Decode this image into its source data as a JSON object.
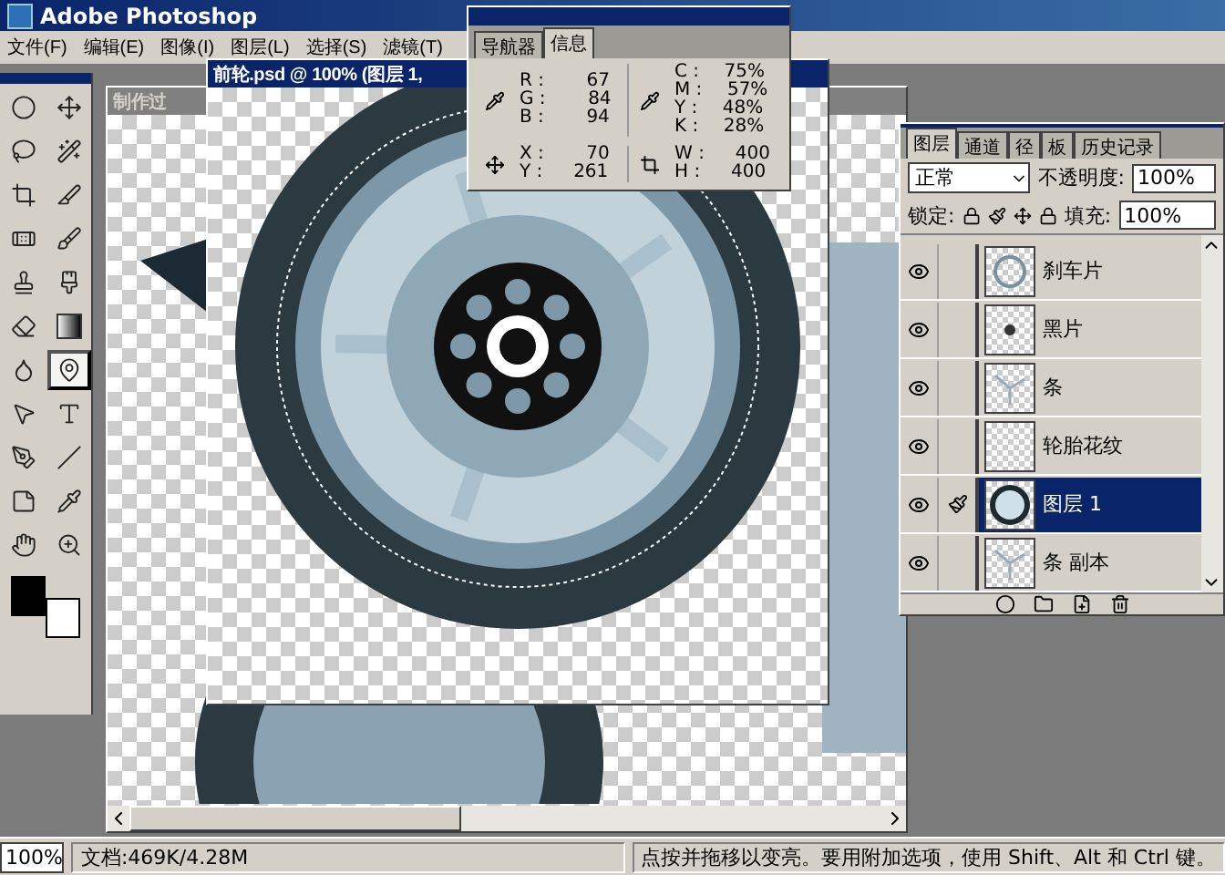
{
  "window": {
    "title": "Adobe Photoshop"
  },
  "menu": [
    "文件(F)",
    "编辑(E)",
    "图像(I)",
    "图层(L)",
    "选择(S)",
    "滤镜(T)"
  ],
  "tools": [
    {
      "kind": "marquee",
      "selected": false
    },
    {
      "kind": "move",
      "selected": false
    },
    {
      "kind": "lasso",
      "selected": false
    },
    {
      "kind": "wand",
      "selected": false
    },
    {
      "kind": "crop",
      "selected": false
    },
    {
      "kind": "slice",
      "selected": false
    },
    {
      "kind": "heal",
      "selected": false
    },
    {
      "kind": "brush",
      "selected": false
    },
    {
      "kind": "stamp",
      "selected": false
    },
    {
      "kind": "history",
      "selected": false
    },
    {
      "kind": "eraser",
      "selected": false
    },
    {
      "kind": "gradient",
      "selected": false
    },
    {
      "kind": "blur",
      "selected": false
    },
    {
      "kind": "dodge",
      "selected": true
    },
    {
      "kind": "select",
      "selected": false
    },
    {
      "kind": "type",
      "selected": false
    },
    {
      "kind": "pen",
      "selected": false
    },
    {
      "kind": "line",
      "selected": false
    },
    {
      "kind": "notes",
      "selected": false
    },
    {
      "kind": "eyedropper",
      "selected": false
    },
    {
      "kind": "hand",
      "selected": false
    },
    {
      "kind": "zoom",
      "selected": false
    }
  ],
  "back_document": {
    "title": "制作过"
  },
  "document": {
    "title": "前轮.psd @ 100% (图层 1,"
  },
  "info": {
    "tabs": [
      {
        "label": "导航器",
        "selected": false
      },
      {
        "label": "信息",
        "selected": true
      }
    ],
    "rgb": [
      {
        "label": "R :",
        "value": "67"
      },
      {
        "label": "G :",
        "value": "84"
      },
      {
        "label": "B :",
        "value": "94"
      }
    ],
    "cmyk": [
      {
        "label": "C :",
        "value": "75%"
      },
      {
        "label": "M :",
        "value": "57%"
      },
      {
        "label": "Y :",
        "value": "48%"
      },
      {
        "label": "K :",
        "value": "28%"
      }
    ],
    "xy": [
      {
        "label": "X :",
        "value": "70"
      },
      {
        "label": "Y :",
        "value": "261"
      }
    ],
    "wh": [
      {
        "label": "W :",
        "value": "400"
      },
      {
        "label": "H :",
        "value": "400"
      }
    ]
  },
  "layers_panel": {
    "tabs": [
      {
        "label": "图层",
        "selected": true
      },
      {
        "label": "通道",
        "selected": false
      },
      {
        "label": "径",
        "selected": false
      },
      {
        "label": "板",
        "selected": false
      },
      {
        "label": "历史记录",
        "selected": false
      }
    ],
    "blend_mode": "正常",
    "opacity_label": "不透明度:",
    "opacity": "100%",
    "lock_label": "锁定:",
    "fill_label": "填充:",
    "fill": "100%",
    "layers": [
      {
        "name": "刹车片",
        "kind": "ring",
        "visible": true,
        "linked": false,
        "selected": false
      },
      {
        "name": "黑片",
        "kind": "dot",
        "visible": true,
        "linked": false,
        "selected": false
      },
      {
        "name": "条",
        "kind": "spokes",
        "visible": true,
        "linked": false,
        "selected": false
      },
      {
        "name": "轮胎花纹",
        "kind": "blank",
        "visible": true,
        "linked": false,
        "selected": false
      },
      {
        "name": "图层 1",
        "kind": "tire",
        "visible": true,
        "linked": true,
        "selected": true
      },
      {
        "name": "条 副本",
        "kind": "spokes",
        "visible": true,
        "linked": false,
        "selected": false
      }
    ]
  },
  "status_bar": {
    "zoom": "100%",
    "doc": "文档:469K/4.28M",
    "hint": "点按并拖移以变亮。要用附加选项，使用 Shift、Alt 和 Ctrl 键。"
  }
}
